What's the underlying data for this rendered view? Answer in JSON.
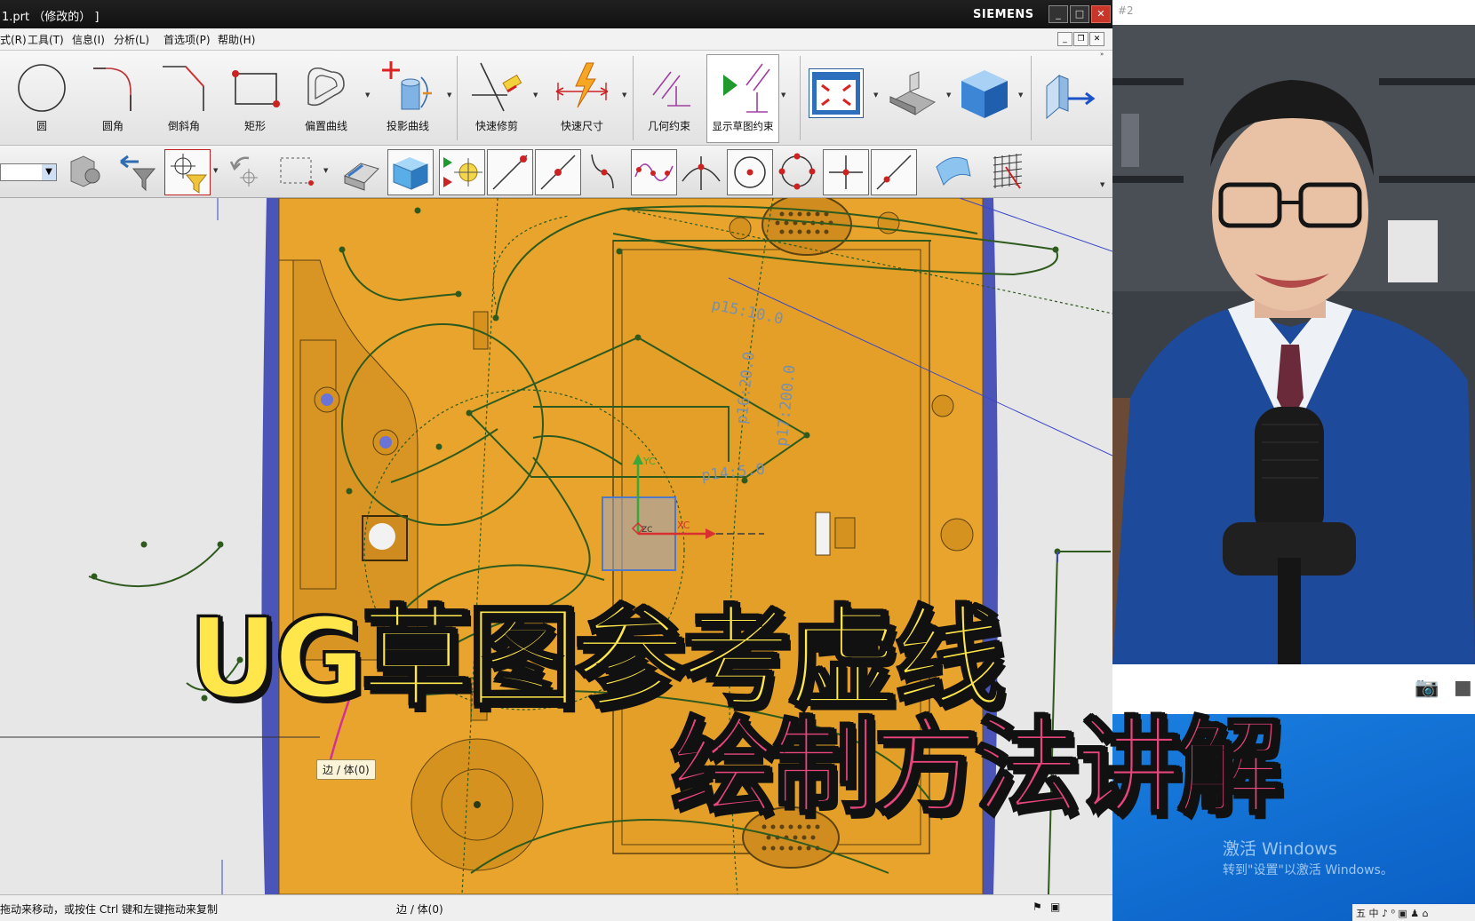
{
  "window": {
    "title": "1.prt （修改的） ]",
    "brand": "SIEMENS",
    "controls": [
      "_",
      "□",
      "✕"
    ]
  },
  "menu": [
    "式(R)",
    "工具(T)",
    "信息(I)",
    "分析(L)",
    "首选项(P)",
    "帮助(H)"
  ],
  "toolbar": {
    "tools": [
      "圆",
      "圆角",
      "倒斜角",
      "矩形",
      "偏置曲线",
      "投影曲线",
      "快速修剪",
      "快速尺寸",
      "几何约束",
      "显示草图约束"
    ]
  },
  "graphics": {
    "dims": [
      "p15:10.0",
      "p16:20.0",
      "p17:200.0",
      "p14:5.0"
    ],
    "axis_y": "YC",
    "axis_x": "XC",
    "axis_z": "ZC"
  },
  "tooltip": "边 / 体(0)",
  "status": {
    "hint": "拖动来移动，或按住 Ctrl 键和左键拖动来复制",
    "selection": "边 / 体(0)"
  },
  "right_panel": {
    "tab": "#2",
    "activation_line1": "激活 Windows",
    "activation_line2": "转到\"设置\"以激活 Windows。",
    "tray": "五 中 ♪ ⁰ ▣ ♟ ⌂"
  },
  "caption": {
    "line1": "UG草图参考虚线",
    "line2": "绘制方法讲解"
  },
  "colors": {
    "part_fill": "#e8a42c",
    "sketch": "#2f5a1e",
    "caption1": "#ffe64a",
    "caption2": "#e7457c",
    "desktop": "#0d6fd0"
  }
}
